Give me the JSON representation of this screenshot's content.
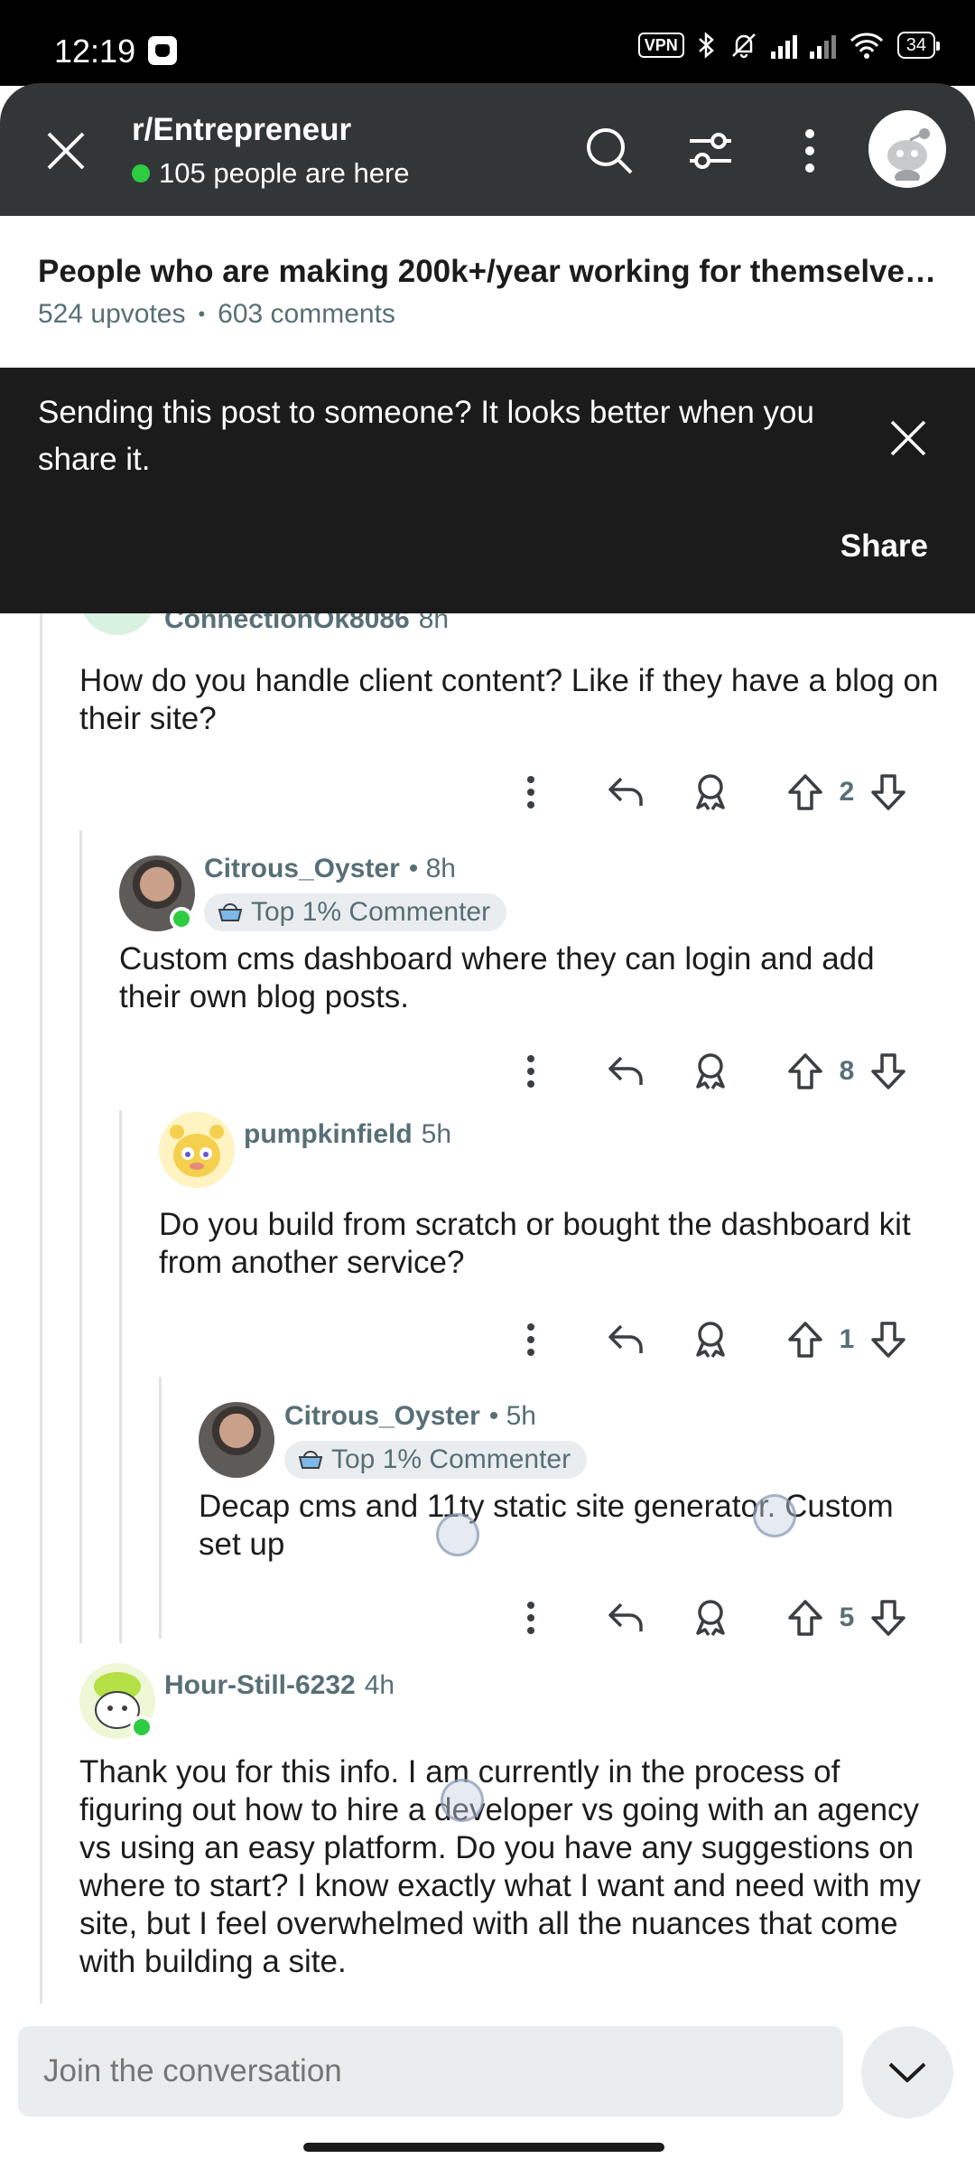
{
  "status_bar": {
    "time": "12:19",
    "vpn": "VPN",
    "battery": "34"
  },
  "header": {
    "subreddit": "r/Entrepreneur",
    "online_text": "105 people are here"
  },
  "post": {
    "title": "People who are making 200k+/year working for themselves,...",
    "upvotes": "524 upvotes",
    "comments": "603 comments"
  },
  "share_toast": {
    "message": "Sending this post to someone? It looks better when you share it.",
    "share_label": "Share"
  },
  "comments": [
    {
      "author": "ConnectionOk8086",
      "time": "8h",
      "body": "How do you handle client content? Like if they have a blog on their site?",
      "votes": "2"
    },
    {
      "author": "Citrous_Oyster",
      "time": "• 8h",
      "badge": "Top 1% Commenter",
      "body": "Custom cms dashboard where they can login and add their own blog posts.",
      "votes": "8"
    },
    {
      "author": "pumpkinfield",
      "time": "5h",
      "body": "Do you build from scratch or bought the dashboard kit from another service?",
      "votes": "1"
    },
    {
      "author": "Citrous_Oyster",
      "time": "• 5h",
      "badge": "Top 1% Commenter",
      "body": "Decap cms and 11ty static site generator. Custom set up",
      "votes": "5"
    },
    {
      "author": "Hour-Still-6232",
      "time": "4h",
      "body": "Thank you for this info. I am currently in the process of figuring out how to hire a developer vs going with an agency vs using an easy platform. Do you have any suggestions on where to start? I know exactly what I want and need with my site, but I feel overwhelmed with all the nuances that come with building a site."
    }
  ],
  "bottom_bar": {
    "placeholder": "Join the conversation"
  },
  "colors": {
    "header_bg": "#333638",
    "toast_bg": "#1b1b1b",
    "online_green": "#2ecc40",
    "meta_gray": "#576f76"
  }
}
